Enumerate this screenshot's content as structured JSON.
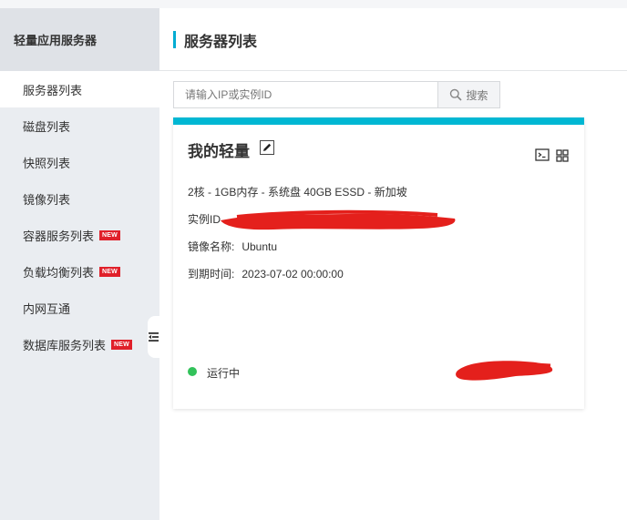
{
  "sidebar": {
    "title": "轻量应用服务器",
    "items": [
      {
        "label": "服务器列表",
        "active": true,
        "badge": ""
      },
      {
        "label": "磁盘列表",
        "active": false,
        "badge": ""
      },
      {
        "label": "快照列表",
        "active": false,
        "badge": ""
      },
      {
        "label": "镜像列表",
        "active": false,
        "badge": ""
      },
      {
        "label": "容器服务列表",
        "active": false,
        "badge": "NEW"
      },
      {
        "label": "负载均衡列表",
        "active": false,
        "badge": "NEW"
      },
      {
        "label": "内网互通",
        "active": false,
        "badge": ""
      },
      {
        "label": "数据库服务列表",
        "active": false,
        "badge": "NEW"
      }
    ]
  },
  "header": {
    "title": "服务器列表"
  },
  "search": {
    "placeholder": "请输入IP或实例ID",
    "button_label": "搜索"
  },
  "instance": {
    "name": "我的轻量",
    "spec": "2核 - 1GB内存 - 系统盘 40GB ESSD - 新加坡",
    "id_label": "实例ID",
    "image_label": "镜像名称:",
    "image_value": "Ubuntu",
    "expiry_label": "到期时间:",
    "expiry_value": "2023-07-02 00:00:00",
    "status": "运行中"
  },
  "colors": {
    "accent": "#00b7d3",
    "badge": "#e0202a",
    "status_running": "#32c25a",
    "redaction": "#e4201c"
  },
  "icons": [
    "edit-icon",
    "terminal-icon",
    "grid-icon",
    "search-icon",
    "collapse-sidebar-icon"
  ]
}
